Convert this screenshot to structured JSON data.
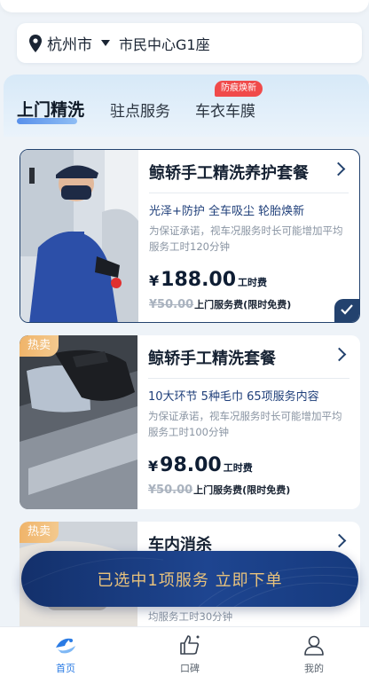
{
  "location": {
    "city": "杭州市",
    "place": "市民中心G1座"
  },
  "tabs": [
    {
      "label": "上门精洗",
      "active": true
    },
    {
      "label": "驻点服务",
      "active": false
    },
    {
      "label": "车衣车膜",
      "active": false,
      "badge": "防痕焕新"
    }
  ],
  "services": [
    {
      "title": "鲸轿手工精洗养护套餐",
      "features": "光泽+防护  全车吸尘  轮胎焕新",
      "note": "为保证承诺，视车况服务时长可能增加平均服务工时120分钟",
      "currency": "¥",
      "price": "188.00",
      "price_unit": "工时费",
      "original": "¥50.00",
      "original_label": "上门服务费(限时免费)",
      "selected": true,
      "image_icon": "technician-photo"
    },
    {
      "title": "鲸轿手工精洗套餐",
      "hot": "热卖",
      "features": "10大环节 5种毛巾 65项服务内容",
      "note": "为保证承诺，视车况服务时长可能增加平均服务工时100分钟",
      "currency": "¥",
      "price": "98.00",
      "price_unit": "工时费",
      "original": "¥50.00",
      "original_label": "上门服务费(限时免费)",
      "selected": false,
      "image_icon": "towel-wipe-photo"
    },
    {
      "title": "车内消杀",
      "hot": "热卖",
      "note_visible": "均服务工时30分钟",
      "selected": false,
      "image_icon": "interior-photo"
    }
  ],
  "order_bar": {
    "label": "已选中1项服务  立即下单"
  },
  "bottom_nav": [
    {
      "label": "首页",
      "icon": "home-icon",
      "active": true
    },
    {
      "label": "口碑",
      "icon": "thumbs-up-icon",
      "active": false
    },
    {
      "label": "我的",
      "icon": "user-icon",
      "active": false
    }
  ],
  "colors": {
    "primary": "#23426e",
    "accent": "#2a7be4",
    "gold": "#e8c27c",
    "hot": "#f0b46a",
    "badge": "#f04a4a"
  }
}
